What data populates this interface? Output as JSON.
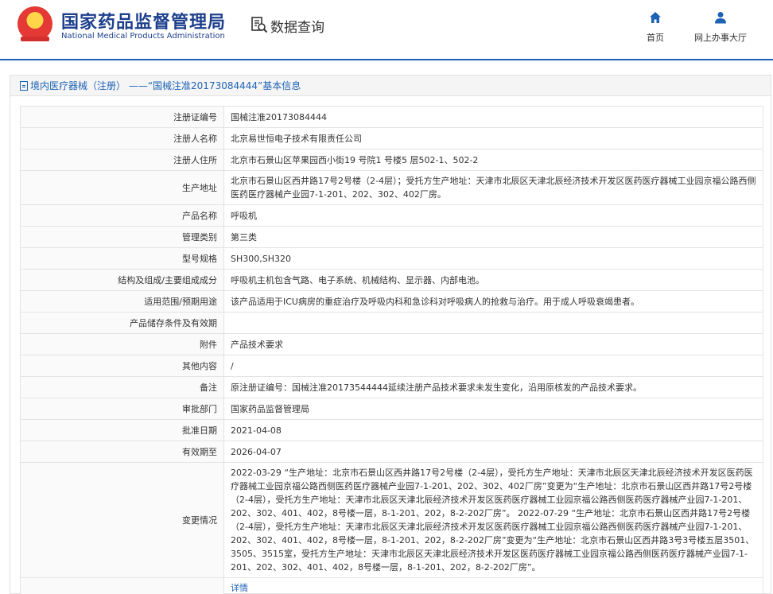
{
  "header": {
    "brand_cn": "国家药品监督管理局",
    "brand_en": "National Medical Products Administration",
    "page_title": "数据查询",
    "nav": [
      {
        "label": "首页",
        "icon": "home-icon"
      },
      {
        "label": "网上办事大厅",
        "icon": "user-icon"
      }
    ]
  },
  "panel": {
    "title": "境内医疗器械（注册） ——“国械注准20173084444”基本信息"
  },
  "fields": [
    {
      "label": "注册证编号",
      "value": "国械注准20173084444"
    },
    {
      "label": "注册人名称",
      "value": "北京易世恒电子技术有限责任公司"
    },
    {
      "label": "注册人住所",
      "value": "北京市石景山区苹果园西小街19 号院1 号楼5 层502-1、502-2"
    },
    {
      "label": "生产地址",
      "value": "北京市石景山区西井路17号2号楼（2-4层）；受托方生产地址：天津市北辰区天津北辰经济技术开发区医药医疗器械工业园京福公路西侧医药医疗器械产业园7-1-201、202、302、402厂房。"
    },
    {
      "label": "产品名称",
      "value": "呼吸机"
    },
    {
      "label": "管理类别",
      "value": "第三类"
    },
    {
      "label": "型号规格",
      "value": "SH300,SH320"
    },
    {
      "label": "结构及组成/主要组成成分",
      "value": "呼吸机主机包含气路、电子系统、机械结构、显示器、内部电池。"
    },
    {
      "label": "适用范围/预期用途",
      "value": "该产品适用于ICU病房的重症治疗及呼吸内科和急诊科对呼吸病人的抢救与治疗。用于成人呼吸衰竭患者。"
    },
    {
      "label": "产品储存条件及有效期",
      "value": ""
    },
    {
      "label": "附件",
      "value": "产品技术要求"
    },
    {
      "label": "其他内容",
      "value": "/"
    },
    {
      "label": "备注",
      "value": "原注册证编号：国械注准20173544444延续注册产品技术要求未发生变化，沿用原核发的产品技术要求。"
    },
    {
      "label": "审批部门",
      "value": "国家药品监督管理局"
    },
    {
      "label": "批准日期",
      "value": "2021-04-08"
    },
    {
      "label": "有效期至",
      "value": "2026-04-07"
    },
    {
      "label": "变更情况",
      "value": "2022-03-29 “生产地址：北京市石景山区西井路17号2号楼（2-4层），受托方生产地址：天津市北辰区天津北辰经济技术开发区医药医疗器械工业园京福公路西侧医药医疗器械产业园7-1-201、202、302、402厂房”变更为“生产地址：北京市石景山区西井路17号2号楼（2-4层），受托方生产地址：天津市北辰区天津北辰经济技术开发区医药医疗器械工业园京福公路西侧医药医疗器械产业园7-1-201、202、302、401、402，8号楼一层，8-1-201、202，8-2-202厂房”。 2022-07-29 “生产地址：北京市石景山区西井路17号2号楼（2-4层），受托方生产地址：天津市北辰区天津北辰经济技术开发区医药医疗器械工业园京福公路西侧医药医疗器械产业园7-1-201、202、302、401、402，8号楼一层，8-1-201、202，8-2-202厂房”变更为“生产地址：北京市石景山区西井路3号3号楼五层3501、3505、3515室，受托方生产地址：天津市北辰区天津北辰经济技术开发区医药医疗器械工业园京福公路西侧医药医疗器械产业园7-1-201、202、302、401、402，8号楼一层，8-1-201、202，8-2-202厂房”。"
    }
  ],
  "partial_row": {
    "label": "",
    "value": "详情"
  }
}
